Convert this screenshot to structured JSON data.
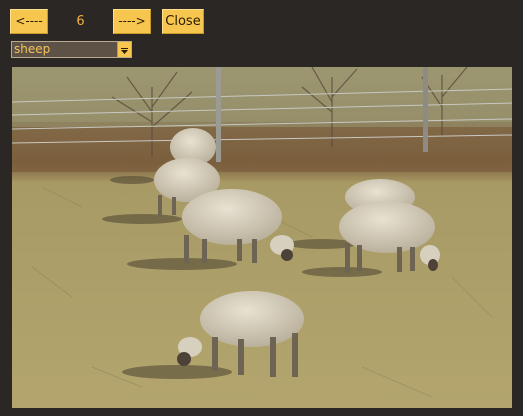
{
  "toolbar": {
    "prev_label": "<----",
    "counter": "6",
    "next_label": "---->",
    "close_label": "Close"
  },
  "filter": {
    "selected": "sheep"
  },
  "colors": {
    "button_bg": "#f6c64e",
    "page_bg": "#2b2724",
    "counter_text": "#f0b33c",
    "select_bg": "#5e5246"
  },
  "icons": {
    "dropdown": "chevron-down-icon"
  }
}
